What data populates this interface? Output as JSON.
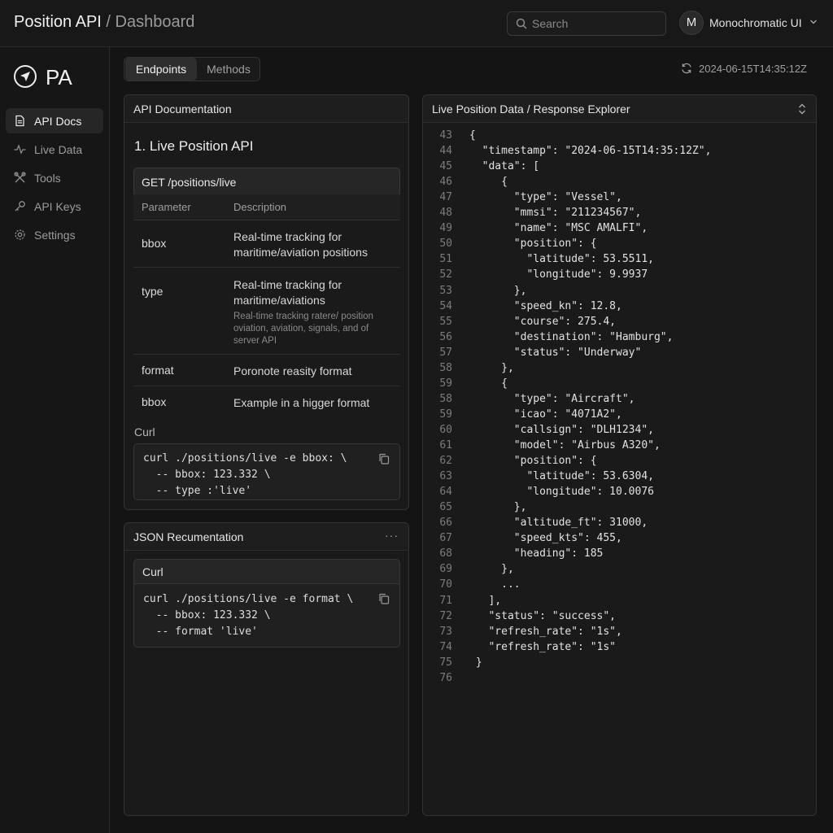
{
  "header": {
    "app_name": "Position API",
    "separator": "/",
    "page": "Dashboard",
    "search_placeholder": "Search",
    "user_initial": "M",
    "user_name": "Monochromatic UI"
  },
  "sidebar": {
    "logo_text": "PA",
    "items": [
      {
        "label": "API Docs",
        "icon": "document-icon",
        "active": true
      },
      {
        "label": "Live Data",
        "icon": "pulse-icon",
        "active": false
      },
      {
        "label": "Tools",
        "icon": "tools-icon",
        "active": false
      },
      {
        "label": "API Keys",
        "icon": "key-icon",
        "active": false
      },
      {
        "label": "Settings",
        "icon": "gear-icon",
        "active": false
      }
    ]
  },
  "tabs": [
    {
      "label": "Endpoints",
      "active": true
    },
    {
      "label": "Methods",
      "active": false
    }
  ],
  "last_updated": "2024-06-15T14:35:12Z",
  "docs_panel": {
    "title": "API Documentation",
    "section_title": "1. Live Position API",
    "endpoint": "GET /positions/live",
    "columns": [
      "Parameter",
      "Description"
    ],
    "rows": [
      {
        "param": "bbox",
        "desc": "Real-time tracking for maritime/aviation positions",
        "note": ""
      },
      {
        "param": "type",
        "desc": "Real-time tracking for maritime/aviations",
        "note": "Real-time tracking ratere/ position oviation, aviation, signals, and of server API"
      },
      {
        "param": "format",
        "desc": "Poronote reasity format",
        "note": ""
      },
      {
        "param": "bbox",
        "desc": "Example in a higger format",
        "note": ""
      }
    ],
    "curl_label": "Curl",
    "curl_lines": [
      "curl ./positions/live -e bbox: \\",
      "  -- bbox: 123.332 \\",
      "  -- type :'live'"
    ]
  },
  "json_panel": {
    "title": "JSON Recumentation",
    "more": "···",
    "curl_label": "Curl",
    "curl_lines": [
      "curl ./positions/live -e format \\",
      "  -- bbox: 123.332 \\",
      "  -- format 'live'"
    ]
  },
  "explorer": {
    "title": "Live Position Data / Response Explorer",
    "lines": [
      {
        "n": "43",
        "t": "{"
      },
      {
        "n": "44",
        "t": "  \"timestamp\": \"2024-06-15T14:35:12Z\","
      },
      {
        "n": "45",
        "t": "  \"data\": ["
      },
      {
        "n": "46",
        "t": "     {"
      },
      {
        "n": "47",
        "t": "       \"type\": \"Vessel\","
      },
      {
        "n": "48",
        "t": "       \"mmsi\": \"211234567\","
      },
      {
        "n": "49",
        "t": "       \"name\": \"MSC AMALFI\","
      },
      {
        "n": "50",
        "t": "       \"position\": {"
      },
      {
        "n": "51",
        "t": "         \"latitude\": 53.5511,"
      },
      {
        "n": "52",
        "t": "         \"longitude\": 9.9937"
      },
      {
        "n": "53",
        "t": "       },"
      },
      {
        "n": "54",
        "t": "       \"speed_kn\": 12.8,"
      },
      {
        "n": "55",
        "t": "       \"course\": 275.4,"
      },
      {
        "n": "56",
        "t": "       \"destination\": \"Hamburg\","
      },
      {
        "n": "57",
        "t": "       \"status\": \"Underway\""
      },
      {
        "n": "58",
        "t": "     },"
      },
      {
        "n": "59",
        "t": "     {"
      },
      {
        "n": "58",
        "t": "       \"type\": \"Aircraft\","
      },
      {
        "n": "59",
        "t": "       \"icao\": \"4071A2\","
      },
      {
        "n": "60",
        "t": "       \"callsign\": \"DLH1234\","
      },
      {
        "n": "61",
        "t": "       \"model\": \"Airbus A320\","
      },
      {
        "n": "62",
        "t": "       \"position\": {"
      },
      {
        "n": "63",
        "t": "         \"latitude\": 53.6304,"
      },
      {
        "n": "64",
        "t": "         \"longitude\": 10.0076"
      },
      {
        "n": "65",
        "t": "       },"
      },
      {
        "n": "66",
        "t": "       \"altitude_ft\": 31000,"
      },
      {
        "n": "67",
        "t": "       \"speed_kts\": 455,"
      },
      {
        "n": "68",
        "t": "       \"heading\": 185"
      },
      {
        "n": "69",
        "t": "     },"
      },
      {
        "n": "70",
        "t": "     ..."
      },
      {
        "n": "71",
        "t": "   ],"
      },
      {
        "n": "72",
        "t": "   \"status\": \"success\","
      },
      {
        "n": "73",
        "t": "   \"refresh_rate\": \"1s\","
      },
      {
        "n": "74",
        "t": "   \"refresh_rate\": \"1s\""
      },
      {
        "n": "75",
        "t": " }"
      },
      {
        "n": "76",
        "t": ""
      }
    ]
  }
}
